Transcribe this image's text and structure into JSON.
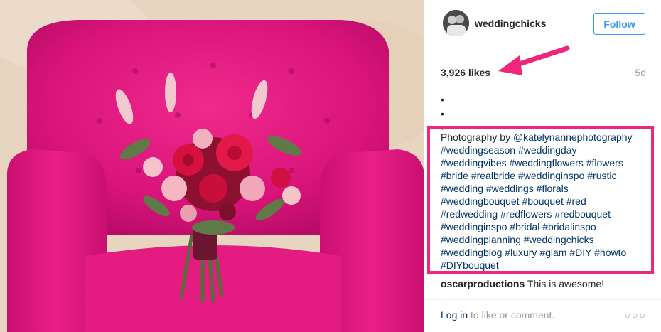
{
  "post": {
    "username": "weddingchicks",
    "follow_label": "Follow",
    "likes": "3,926 likes",
    "age": "5d",
    "caption_dots": [
      "•",
      "•",
      "•"
    ],
    "caption_lines": [
      [
        {
          "t": "Photography by ",
          "tag": false
        },
        {
          "t": "@katelynannephotography",
          "tag": true
        }
      ],
      [
        {
          "t": "#weddingseason",
          "tag": true
        },
        {
          "t": " ",
          "tag": false
        },
        {
          "t": "#weddingday",
          "tag": true
        }
      ],
      [
        {
          "t": "#weddingvibes",
          "tag": true
        },
        {
          "t": " ",
          "tag": false
        },
        {
          "t": "#weddingflowers",
          "tag": true
        },
        {
          "t": " ",
          "tag": false
        },
        {
          "t": "#flowers",
          "tag": true
        }
      ],
      [
        {
          "t": "#bride",
          "tag": true
        },
        {
          "t": " ",
          "tag": false
        },
        {
          "t": "#realbride",
          "tag": true
        },
        {
          "t": " ",
          "tag": false
        },
        {
          "t": "#weddinginspo",
          "tag": true
        },
        {
          "t": " ",
          "tag": false
        },
        {
          "t": "#rustic",
          "tag": true
        }
      ],
      [
        {
          "t": "#wedding",
          "tag": true
        },
        {
          "t": " ",
          "tag": false
        },
        {
          "t": "#weddings",
          "tag": true
        },
        {
          "t": " ",
          "tag": false
        },
        {
          "t": "#florals",
          "tag": true
        }
      ],
      [
        {
          "t": "#weddingbouquet",
          "tag": true
        },
        {
          "t": " ",
          "tag": false
        },
        {
          "t": "#bouquet",
          "tag": true
        },
        {
          "t": " ",
          "tag": false
        },
        {
          "t": "#red",
          "tag": true
        }
      ],
      [
        {
          "t": "#redwedding",
          "tag": true
        },
        {
          "t": " ",
          "tag": false
        },
        {
          "t": "#redflowers",
          "tag": true
        },
        {
          "t": " ",
          "tag": false
        },
        {
          "t": "#redbouquet",
          "tag": true
        }
      ],
      [
        {
          "t": "#weddinginspo",
          "tag": true
        },
        {
          "t": " ",
          "tag": false
        },
        {
          "t": "#bridal",
          "tag": true
        },
        {
          "t": " ",
          "tag": false
        },
        {
          "t": "#bridalinspo",
          "tag": true
        }
      ],
      [
        {
          "t": "#weddingplanning",
          "tag": true
        },
        {
          "t": " ",
          "tag": false
        },
        {
          "t": "#weddingchicks",
          "tag": true
        }
      ],
      [
        {
          "t": "#weddingblog",
          "tag": true
        },
        {
          "t": " ",
          "tag": false
        },
        {
          "t": "#luxury",
          "tag": true
        },
        {
          "t": " ",
          "tag": false
        },
        {
          "t": "#glam",
          "tag": true
        },
        {
          "t": " ",
          "tag": false
        },
        {
          "t": "#DIY",
          "tag": true
        },
        {
          "t": " ",
          "tag": false
        },
        {
          "t": "#howto",
          "tag": true
        }
      ],
      [
        {
          "t": "#DIYbouquet",
          "tag": true
        }
      ]
    ],
    "comment": {
      "user": "oscarproductions",
      "text": " This is awesome!"
    },
    "login_link": "Log in",
    "login_rest": " to like or comment.",
    "more_glyph": "○○○"
  },
  "colors": {
    "accent_blue": "#3897f0",
    "hashtag_blue": "#003569",
    "highlight_pink": "#f0267a",
    "chair_pink": "#e0147a"
  },
  "icons": {
    "avatar": "avatar-photo",
    "arrow": "pink-arrow-annotation",
    "more": "more-options-icon"
  }
}
